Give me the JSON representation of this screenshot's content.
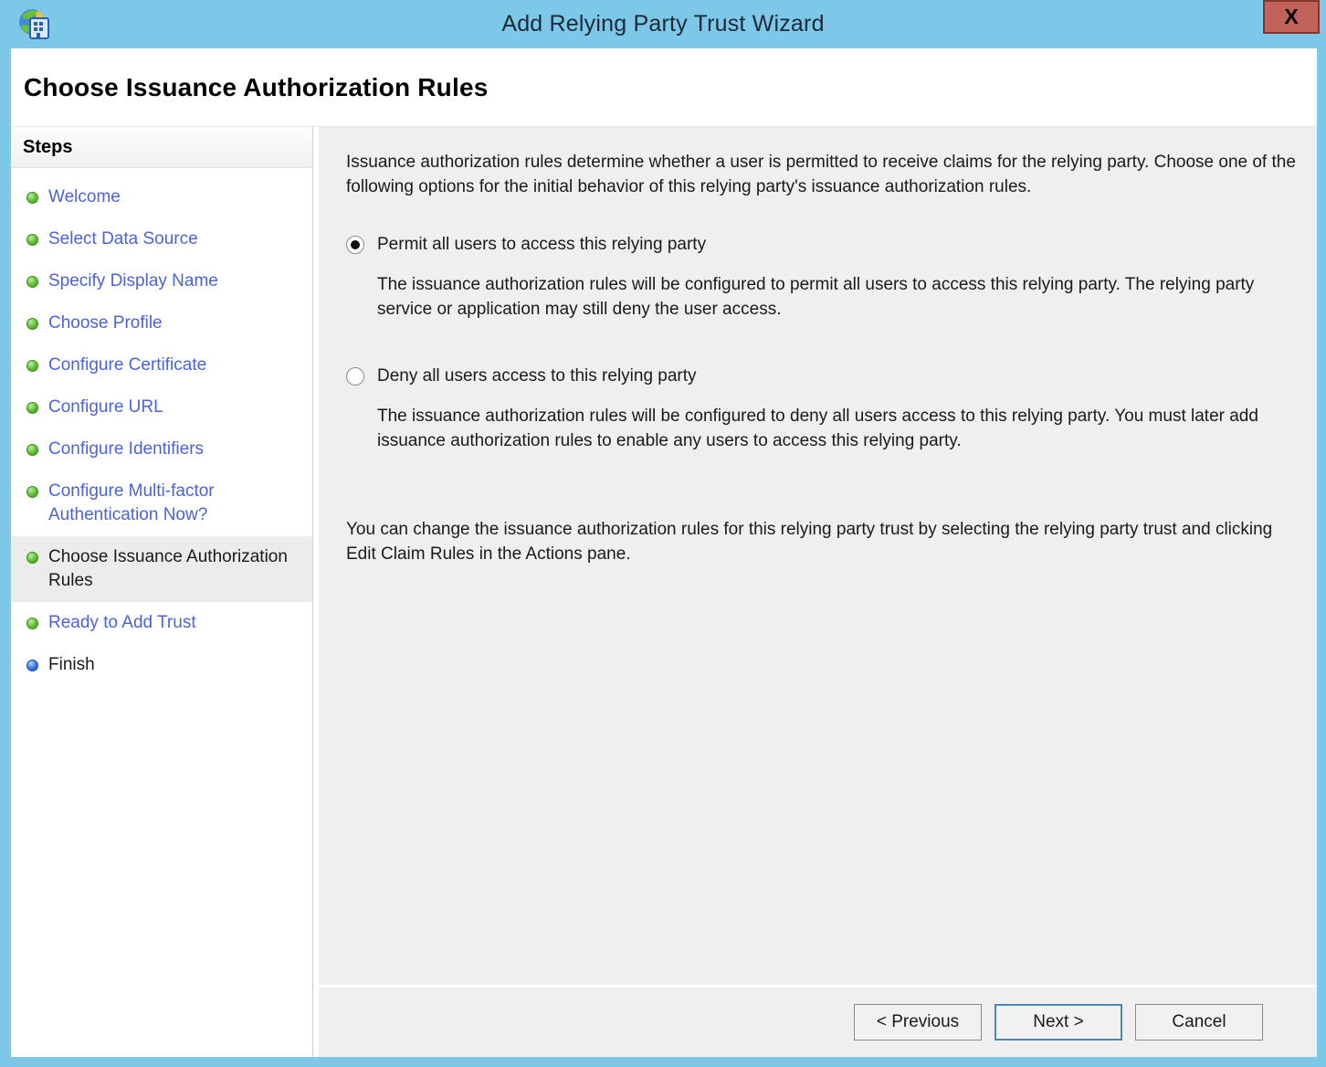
{
  "window": {
    "title": "Add Relying Party Trust Wizard",
    "close_glyph": "X"
  },
  "page": {
    "heading": "Choose Issuance Authorization Rules"
  },
  "sidebar": {
    "heading": "Steps",
    "items": [
      {
        "label": "Welcome",
        "state": "done"
      },
      {
        "label": "Select Data Source",
        "state": "done"
      },
      {
        "label": "Specify Display Name",
        "state": "done"
      },
      {
        "label": "Choose Profile",
        "state": "done"
      },
      {
        "label": "Configure Certificate",
        "state": "done"
      },
      {
        "label": "Configure URL",
        "state": "done"
      },
      {
        "label": "Configure Identifiers",
        "state": "done"
      },
      {
        "label": "Configure Multi-factor Authentication Now?",
        "state": "done"
      },
      {
        "label": "Choose Issuance Authorization Rules",
        "state": "current"
      },
      {
        "label": "Ready to Add Trust",
        "state": "done"
      },
      {
        "label": "Finish",
        "state": "future"
      }
    ]
  },
  "content": {
    "intro": "Issuance authorization rules determine whether a user is permitted to receive claims for the relying party. Choose one of the following options for the initial behavior of this relying party's issuance authorization rules.",
    "options": [
      {
        "label": "Permit all users to access this relying party",
        "selected": true,
        "description": "The issuance authorization rules will be configured to permit all users to access this relying party. The relying party service or application may still deny the user access."
      },
      {
        "label": "Deny all users access to this relying party",
        "selected": false,
        "description": "The issuance authorization rules will be configured to deny all users access to this relying party. You must later add issuance authorization rules to enable any users to access this relying party."
      }
    ],
    "note": "You can change the issuance authorization rules for this relying party trust by selecting the relying party trust and clicking Edit Claim Rules in the Actions pane."
  },
  "footer": {
    "previous_label": "< Previous",
    "next_label": "Next >",
    "cancel_label": "Cancel"
  },
  "colors": {
    "titlebar_blue": "#7DC7E8",
    "close_red": "#C1625B",
    "link_blue": "#4A63D8",
    "bullet_green": "#57B72F",
    "bullet_blue": "#3575E8",
    "content_gray": "#EFEFEF",
    "current_step_bg": "#ECECEC"
  }
}
